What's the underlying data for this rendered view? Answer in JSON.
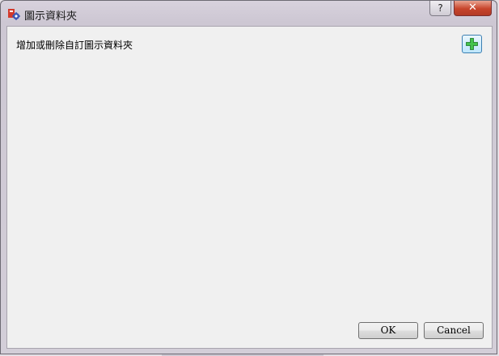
{
  "window": {
    "title": "圖示資料夾",
    "help_label": "?",
    "close_label": "✕"
  },
  "main": {
    "instruction": "增加或刪除自訂圖示資料夾"
  },
  "buttons": {
    "ok_label": "OK",
    "cancel_label": "Cancel"
  },
  "icons": {
    "app": "app-gear-icon",
    "add": "plus-icon"
  },
  "colors": {
    "add_plus": "#3cb043",
    "close_button": "#c7442b"
  }
}
